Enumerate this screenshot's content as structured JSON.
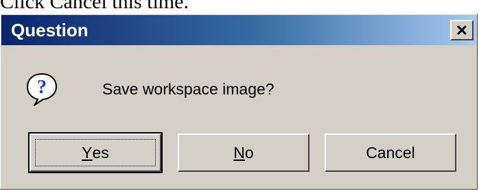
{
  "caption": "Click Cancel this time.",
  "dialog": {
    "title": "Question",
    "close_glyph": "×",
    "icon": "question-mark-balloon-icon",
    "message": "Save workspace image?",
    "buttons": {
      "yes": {
        "accel": "Y",
        "rest": "es"
      },
      "no": {
        "accel": "N",
        "rest": "o"
      },
      "cancel": {
        "label": "Cancel"
      }
    }
  },
  "colors": {
    "titlebar_start": "#0a246a",
    "titlebar_end": "#a6caf0",
    "face": "#d4d0c8"
  }
}
